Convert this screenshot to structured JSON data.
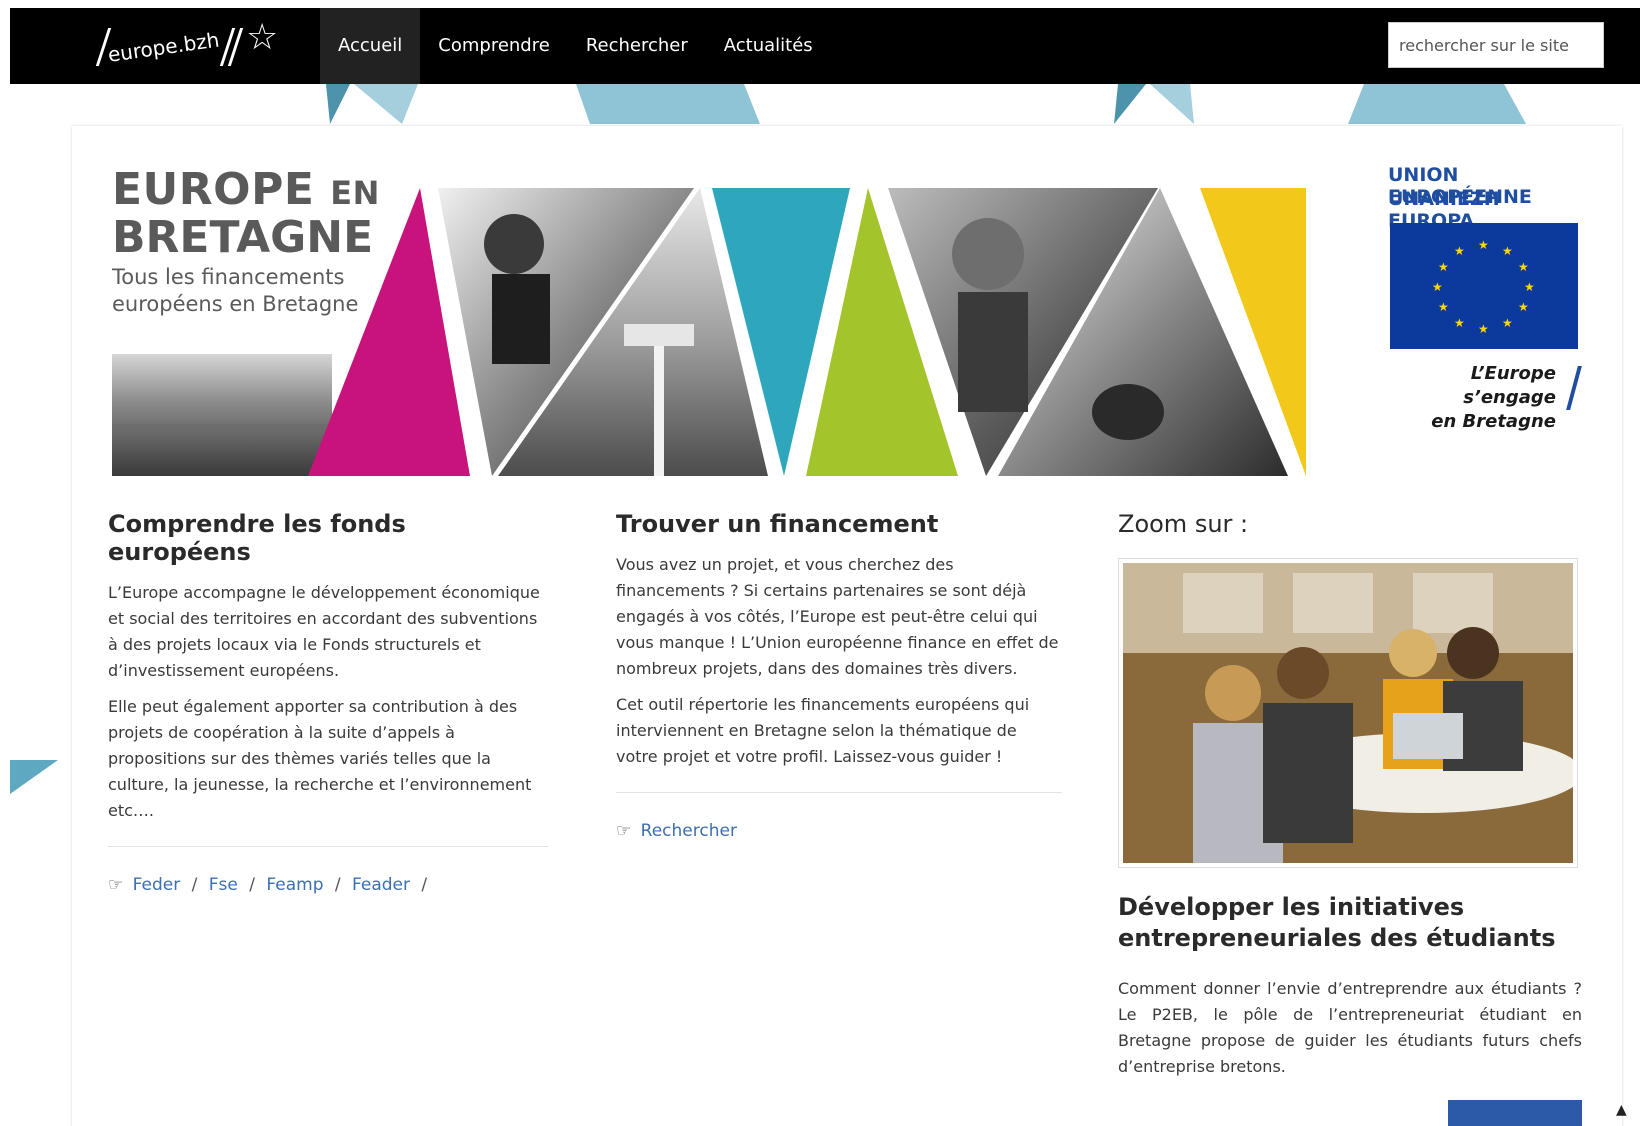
{
  "site": {
    "logo_text": "europe.bzh"
  },
  "nav": {
    "items": [
      {
        "label": "Accueil",
        "active": true
      },
      {
        "label": "Comprendre",
        "active": false
      },
      {
        "label": "Rechercher",
        "active": false
      },
      {
        "label": "Actualités",
        "active": false
      }
    ],
    "search_placeholder": "rechercher sur le site"
  },
  "banner": {
    "title_line1_main": "EUROPE",
    "title_line1_small": "EN",
    "title_line2": "BRETAGNE",
    "tagline_line1": "Tous les financements",
    "tagline_line2": "européens en Bretagne",
    "eu_line1": "UNION EUROPÉENNE",
    "eu_line2": "UNANIEZH EUROPA",
    "slogan_line1": "L’Europe s’engage",
    "slogan_line2": "en Bretagne",
    "triangle_colors": [
      "#c8127c",
      "#2ea7bd",
      "#a3c42a",
      "#f2c81b"
    ]
  },
  "columns": {
    "comprendre": {
      "title": "Comprendre les fonds européens",
      "p1": "L’Europe accompagne le développement économique et social des territoires en accordant des subventions à des projets locaux via le Fonds structurels et d’investissement européens.",
      "p2": "Elle peut également apporter sa contribution à des projets de coopération à la suite d’appels à propositions sur des thèmes variés telles que la culture, la jeunesse, la recherche et l’environnement etc….",
      "links": [
        "Feder",
        "Fse",
        "Feamp",
        "Feader"
      ],
      "link_separator": "/"
    },
    "trouver": {
      "title": "Trouver un financement",
      "p1": "Vous avez un projet, et vous cherchez des financements ? Si certains partenaires se sont déjà engagés à vos côtés, l’Europe est peut-être celui qui vous manque ! L’Union européenne finance en effet de nombreux projets, dans des domaines très divers.",
      "p2": "Cet outil répertorie les financements européens qui interviennent en Bretagne selon la thématique de votre projet et votre profil. Laissez-vous guider !",
      "link": "Rechercher"
    },
    "zoom": {
      "title": "Zoom sur :",
      "article_title": "Développer les initiatives entrepreneuriales des étudiants",
      "article_text": "Comment donner l’envie d’entreprendre aux étudiants ? Le P2EB, le pôle de l’entrepreneuriat étudiant en Bretagne propose de guider les étudiants futurs chefs d’entreprise bretons."
    }
  },
  "icons": {
    "link": "pointing-hand-icon",
    "scroll_top": "caret-up-icon"
  },
  "colors": {
    "nav_bg": "#000000",
    "accent_teal": "#5fa8c2",
    "link_blue": "#3b6fb0",
    "eu_blue": "#1f4ea0"
  }
}
